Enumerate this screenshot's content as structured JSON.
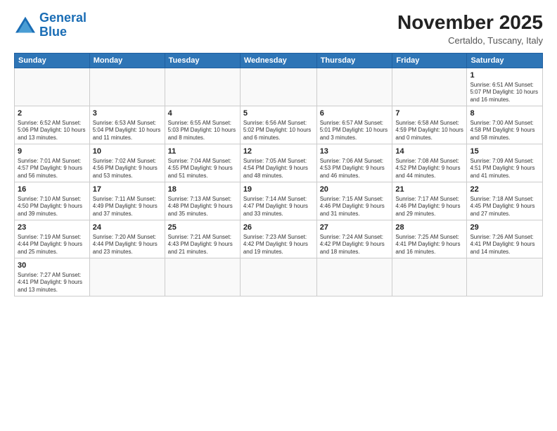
{
  "logo": {
    "text_general": "General",
    "text_blue": "Blue"
  },
  "header": {
    "month_year": "November 2025",
    "location": "Certaldo, Tuscany, Italy"
  },
  "weekdays": [
    "Sunday",
    "Monday",
    "Tuesday",
    "Wednesday",
    "Thursday",
    "Friday",
    "Saturday"
  ],
  "weeks": [
    [
      {
        "day": "",
        "info": ""
      },
      {
        "day": "",
        "info": ""
      },
      {
        "day": "",
        "info": ""
      },
      {
        "day": "",
        "info": ""
      },
      {
        "day": "",
        "info": ""
      },
      {
        "day": "",
        "info": ""
      },
      {
        "day": "1",
        "info": "Sunrise: 6:51 AM\nSunset: 5:07 PM\nDaylight: 10 hours and 16 minutes."
      }
    ],
    [
      {
        "day": "2",
        "info": "Sunrise: 6:52 AM\nSunset: 5:06 PM\nDaylight: 10 hours and 13 minutes."
      },
      {
        "day": "3",
        "info": "Sunrise: 6:53 AM\nSunset: 5:04 PM\nDaylight: 10 hours and 11 minutes."
      },
      {
        "day": "4",
        "info": "Sunrise: 6:55 AM\nSunset: 5:03 PM\nDaylight: 10 hours and 8 minutes."
      },
      {
        "day": "5",
        "info": "Sunrise: 6:56 AM\nSunset: 5:02 PM\nDaylight: 10 hours and 6 minutes."
      },
      {
        "day": "6",
        "info": "Sunrise: 6:57 AM\nSunset: 5:01 PM\nDaylight: 10 hours and 3 minutes."
      },
      {
        "day": "7",
        "info": "Sunrise: 6:58 AM\nSunset: 4:59 PM\nDaylight: 10 hours and 0 minutes."
      },
      {
        "day": "8",
        "info": "Sunrise: 7:00 AM\nSunset: 4:58 PM\nDaylight: 9 hours and 58 minutes."
      }
    ],
    [
      {
        "day": "9",
        "info": "Sunrise: 7:01 AM\nSunset: 4:57 PM\nDaylight: 9 hours and 56 minutes."
      },
      {
        "day": "10",
        "info": "Sunrise: 7:02 AM\nSunset: 4:56 PM\nDaylight: 9 hours and 53 minutes."
      },
      {
        "day": "11",
        "info": "Sunrise: 7:04 AM\nSunset: 4:55 PM\nDaylight: 9 hours and 51 minutes."
      },
      {
        "day": "12",
        "info": "Sunrise: 7:05 AM\nSunset: 4:54 PM\nDaylight: 9 hours and 48 minutes."
      },
      {
        "day": "13",
        "info": "Sunrise: 7:06 AM\nSunset: 4:53 PM\nDaylight: 9 hours and 46 minutes."
      },
      {
        "day": "14",
        "info": "Sunrise: 7:08 AM\nSunset: 4:52 PM\nDaylight: 9 hours and 44 minutes."
      },
      {
        "day": "15",
        "info": "Sunrise: 7:09 AM\nSunset: 4:51 PM\nDaylight: 9 hours and 41 minutes."
      }
    ],
    [
      {
        "day": "16",
        "info": "Sunrise: 7:10 AM\nSunset: 4:50 PM\nDaylight: 9 hours and 39 minutes."
      },
      {
        "day": "17",
        "info": "Sunrise: 7:11 AM\nSunset: 4:49 PM\nDaylight: 9 hours and 37 minutes."
      },
      {
        "day": "18",
        "info": "Sunrise: 7:13 AM\nSunset: 4:48 PM\nDaylight: 9 hours and 35 minutes."
      },
      {
        "day": "19",
        "info": "Sunrise: 7:14 AM\nSunset: 4:47 PM\nDaylight: 9 hours and 33 minutes."
      },
      {
        "day": "20",
        "info": "Sunrise: 7:15 AM\nSunset: 4:46 PM\nDaylight: 9 hours and 31 minutes."
      },
      {
        "day": "21",
        "info": "Sunrise: 7:17 AM\nSunset: 4:46 PM\nDaylight: 9 hours and 29 minutes."
      },
      {
        "day": "22",
        "info": "Sunrise: 7:18 AM\nSunset: 4:45 PM\nDaylight: 9 hours and 27 minutes."
      }
    ],
    [
      {
        "day": "23",
        "info": "Sunrise: 7:19 AM\nSunset: 4:44 PM\nDaylight: 9 hours and 25 minutes."
      },
      {
        "day": "24",
        "info": "Sunrise: 7:20 AM\nSunset: 4:44 PM\nDaylight: 9 hours and 23 minutes."
      },
      {
        "day": "25",
        "info": "Sunrise: 7:21 AM\nSunset: 4:43 PM\nDaylight: 9 hours and 21 minutes."
      },
      {
        "day": "26",
        "info": "Sunrise: 7:23 AM\nSunset: 4:42 PM\nDaylight: 9 hours and 19 minutes."
      },
      {
        "day": "27",
        "info": "Sunrise: 7:24 AM\nSunset: 4:42 PM\nDaylight: 9 hours and 18 minutes."
      },
      {
        "day": "28",
        "info": "Sunrise: 7:25 AM\nSunset: 4:41 PM\nDaylight: 9 hours and 16 minutes."
      },
      {
        "day": "29",
        "info": "Sunrise: 7:26 AM\nSunset: 4:41 PM\nDaylight: 9 hours and 14 minutes."
      }
    ],
    [
      {
        "day": "30",
        "info": "Sunrise: 7:27 AM\nSunset: 4:41 PM\nDaylight: 9 hours and 13 minutes."
      },
      {
        "day": "",
        "info": ""
      },
      {
        "day": "",
        "info": ""
      },
      {
        "day": "",
        "info": ""
      },
      {
        "day": "",
        "info": ""
      },
      {
        "day": "",
        "info": ""
      },
      {
        "day": "",
        "info": ""
      }
    ]
  ]
}
